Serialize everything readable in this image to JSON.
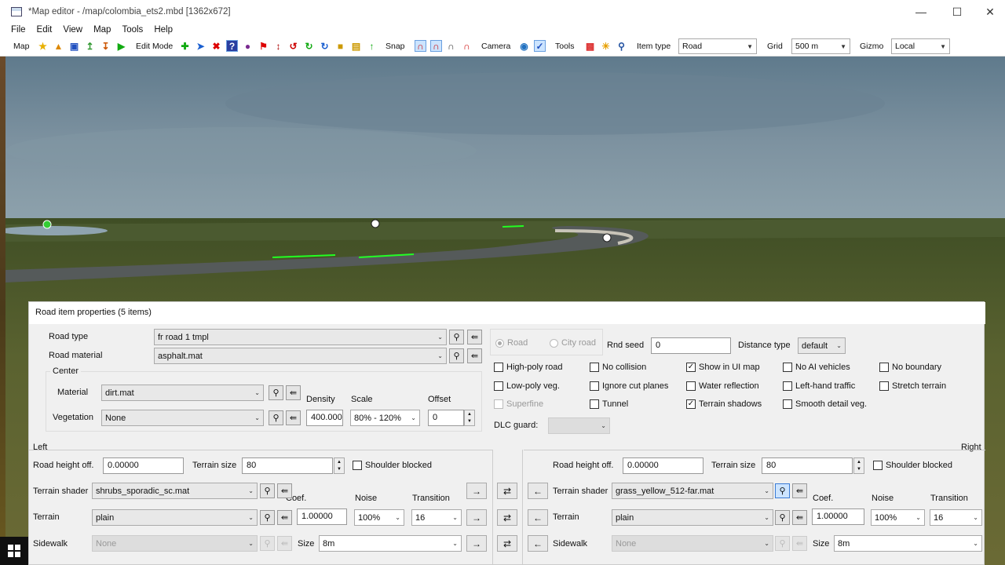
{
  "window": {
    "title": "*Map editor - /map/colombia_ets2.mbd [1362x672]"
  },
  "menu": [
    "File",
    "Edit",
    "View",
    "Map",
    "Tools",
    "Help"
  ],
  "toolbar": {
    "map": "Map",
    "edit_mode": "Edit Mode",
    "snap": "Snap",
    "camera": "Camera",
    "tools": "Tools",
    "item_type_label": "Item type",
    "item_type_value": "Road",
    "grid_label": "Grid",
    "grid_value": "500 m",
    "gizmo_label": "Gizmo",
    "gizmo_value": "Local"
  },
  "panel": {
    "title": "Road item properties (5 items)",
    "road_type_label": "Road type",
    "road_type_value": "fr road 1 tmpl",
    "road_material_label": "Road material",
    "road_material_value": "asphalt.mat",
    "center_label": "Center",
    "material_label": "Material",
    "material_value": "dirt.mat",
    "vegetation_label": "Vegetation",
    "vegetation_value": "None",
    "density_label": "Density",
    "density_value": "400.0000",
    "scale_label": "Scale",
    "scale_value": "80% - 120%",
    "offset_label": "Offset",
    "offset_value": "0",
    "radio_road": "Road",
    "radio_city": "City road",
    "rnd_seed_label": "Rnd seed",
    "rnd_seed_value": "0",
    "distance_type_label": "Distance type",
    "distance_type_value": "default",
    "dlc_guard_label": "DLC guard:",
    "checks": {
      "high_poly": "High-poly road",
      "low_poly": "Low-poly veg.",
      "superfine": "Superfine",
      "no_collision": "No collision",
      "ignore_cut": "Ignore cut planes",
      "tunnel": "Tunnel",
      "show_ui": "Show in UI map",
      "water_refl": "Water reflection",
      "terrain_shadows": "Terrain shadows",
      "no_ai": "No AI vehicles",
      "left_hand": "Left-hand traffic",
      "smooth_detail": "Smooth detail veg.",
      "no_boundary": "No boundary",
      "stretch": "Stretch terrain"
    },
    "left": {
      "heading": "Left",
      "road_height_label": "Road height off.",
      "road_height_value": "0.00000",
      "terrain_size_label": "Terrain size",
      "terrain_size_value": "80",
      "shoulder": "Shoulder blocked",
      "terrain_shader_label": "Terrain shader",
      "terrain_shader_value": "shrubs_sporadic_sc.mat",
      "terrain_label": "Terrain",
      "terrain_value": "plain",
      "sidewalk_label": "Sidewalk",
      "sidewalk_value": "None",
      "coef_label": "Coef.",
      "coef_value": "1.00000",
      "noise_label": "Noise",
      "noise_value": "100%",
      "transition_label": "Transition",
      "transition_value": "16",
      "size_label": "Size",
      "size_value": "8m"
    },
    "right": {
      "heading": "Right",
      "road_height_label": "Road height off.",
      "road_height_value": "0.00000",
      "terrain_size_label": "Terrain size",
      "terrain_size_value": "80",
      "shoulder": "Shoulder blocked",
      "terrain_shader_label": "Terrain shader",
      "terrain_shader_value": "grass_yellow_512-far.mat",
      "terrain_label": "Terrain",
      "terrain_value": "plain",
      "sidewalk_label": "Sidewalk",
      "sidewalk_value": "None",
      "coef_label": "Coef.",
      "coef_value": "1.00000",
      "noise_label": "Noise",
      "noise_value": "100%",
      "transition_label": "Transition",
      "transition_value": "16",
      "size_label": "Size",
      "size_value": "8m"
    }
  }
}
